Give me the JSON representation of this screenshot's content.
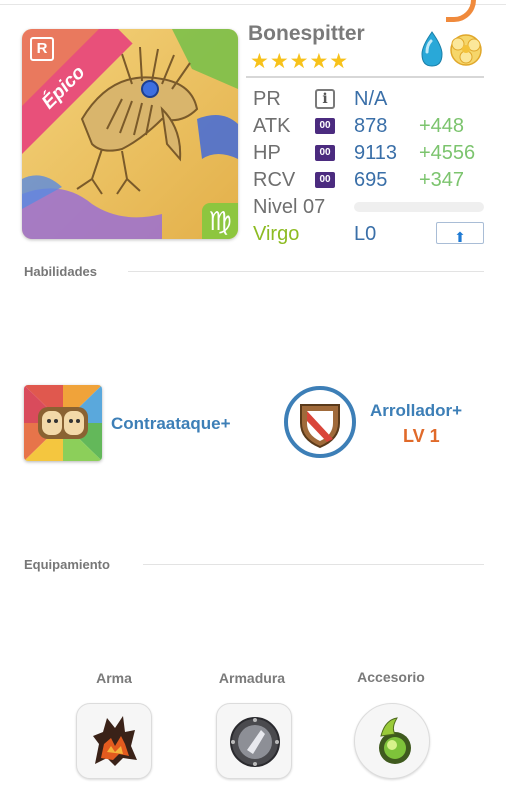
{
  "monster": {
    "name": "Bonespitter",
    "stars": "★★★★★",
    "rarity": "Épico",
    "rank_badge": "R",
    "zodiac_symbol": "♍",
    "elements": [
      "water-drop-icon",
      "light-swirl-icon"
    ]
  },
  "stats": [
    {
      "label": "PR",
      "badge": "i",
      "value": "N/A",
      "bonus": ""
    },
    {
      "label": "ATK",
      "badge": "00",
      "value": "878",
      "bonus": "+448"
    },
    {
      "label": "HP",
      "badge": "00",
      "value": "9113",
      "bonus": "+4556"
    },
    {
      "label": "RCV",
      "badge": "00",
      "value": "695",
      "bonus": "+347"
    }
  ],
  "level": {
    "label": "Nivel 07",
    "progress": 0
  },
  "zodiac": {
    "name": "Virgo",
    "limit": "L0",
    "upgrade_icon": "arrow-up-icon"
  },
  "sections": {
    "skills_title": "Habilidades",
    "equipment_title": "Equipamiento"
  },
  "skills": [
    {
      "name": "Contraataque+",
      "level": "",
      "icon": "pig-faces-icon"
    },
    {
      "name": "Arrollador+",
      "level": "LV 1",
      "icon": "shield-icon"
    }
  ],
  "equipment": [
    {
      "label": "Arma",
      "icon": "flame-weapon-icon"
    },
    {
      "label": "Armadura",
      "icon": "armor-shield-icon"
    },
    {
      "label": "Accesorio",
      "icon": "green-orb-icon"
    }
  ],
  "colors": {
    "rarity": "#e8507a",
    "zodiac": "#8dc63f",
    "value_blue": "#3a6fa8",
    "bonus_green": "#7cc46e",
    "skill_blue": "#3d7fb7",
    "skill_level_orange": "#e06a2a",
    "stat_badge": "#4b2b7f"
  }
}
